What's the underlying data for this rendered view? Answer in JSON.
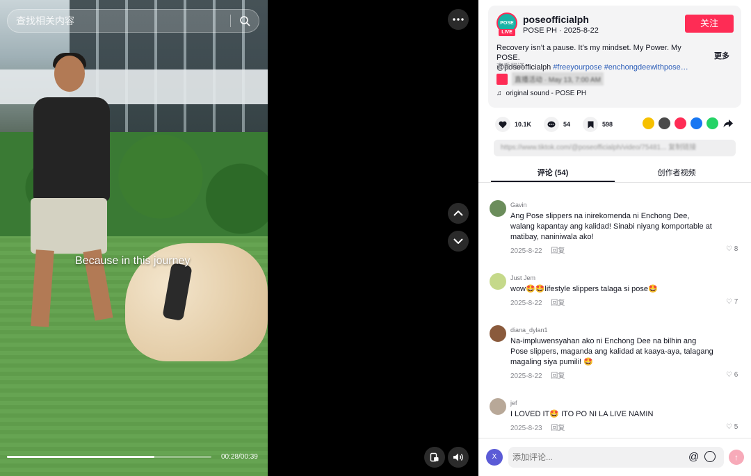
{
  "video": {
    "search_placeholder": "查找相关内容",
    "caption": "Because in this journey",
    "progress_fraction": 0.72,
    "time": "00:28/00:39"
  },
  "post": {
    "logo_text": "POSE",
    "live_tag": "LIVE",
    "handle": "poseofficialph",
    "subline": "POSE PH · 2025-8-22",
    "follow_label": "关注",
    "description": "Recovery isn’t a pause. It’s my mindset. My Power. My POSE.",
    "mention": "@poseofficialph",
    "hashtags": "#freeyourpose #enchongdeewithpose…",
    "more_label": "更多",
    "translate_label": "查看翻译",
    "event_text": "直播活动 · May 13, 7:00 AM",
    "sound": "original sound - POSE PH"
  },
  "stats": {
    "likes": "10.1K",
    "comments": "54",
    "saves": "598"
  },
  "share_colors": [
    "#f6c000",
    "#4a4a4a",
    "#fe2c55",
    "#1877f2",
    "#25d366"
  ],
  "link_text": "https://www.tiktok.com/@poseofficialph/video/75481...   复制链接",
  "tabs": [
    {
      "label": "评论 (54)"
    },
    {
      "label": "创作者视频"
    }
  ],
  "comments": [
    {
      "name": "Gavin",
      "text": "Ang Pose slippers na inirekomenda ni Enchong Dee, walang kapantay ang kalidad! Sinabi niyang komportable at matibay, naniniwala ako!",
      "date": "2025-8-22",
      "reply": "回复",
      "likes": "8"
    },
    {
      "name": "Just Jem",
      "text": "wow🤩🤩lifestyle slippers talaga si pose🤩",
      "date": "2025-8-22",
      "reply": "回复",
      "likes": "7"
    },
    {
      "name": "diana_dylan1",
      "text": "Na-impluwensyahan ako ni Enchong Dee na bilhin ang Pose slippers, maganda ang kalidad at kaaya-aya, talagang magaling siya pumili! 🤩",
      "date": "2025-8-22",
      "reply": "回复",
      "likes": "6"
    },
    {
      "name": "jef",
      "text": "I LOVED IT🤩 ITO PO NI LA LIVE NAMIN",
      "date": "2025-8-23",
      "reply": "回复",
      "likes": "5"
    }
  ],
  "composer": {
    "avatar_letter": "X",
    "placeholder": "添加评论...",
    "at_symbol": "@"
  },
  "icons": {
    "more": "more-icon",
    "up": "chevron-up-icon",
    "down": "chevron-down-icon",
    "mini": "mini-player-icon",
    "volume": "volume-icon"
  }
}
